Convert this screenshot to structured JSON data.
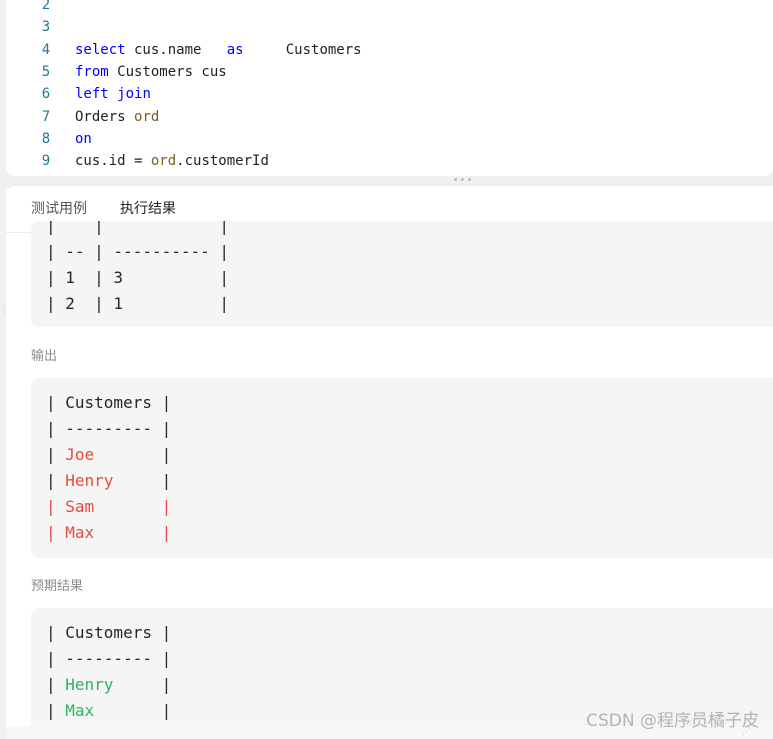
{
  "editor": {
    "lines": [
      {
        "num": "2",
        "tokens": []
      },
      {
        "num": "3",
        "tokens": []
      },
      {
        "num": "4",
        "tokens": [
          {
            "t": "select",
            "c": "kw"
          },
          {
            "t": " cus.name   ",
            "c": ""
          },
          {
            "t": "as",
            "c": "kw"
          },
          {
            "t": "     Customers",
            "c": ""
          }
        ]
      },
      {
        "num": "5",
        "tokens": [
          {
            "t": "from",
            "c": "kw"
          },
          {
            "t": " Customers cus",
            "c": ""
          }
        ]
      },
      {
        "num": "6",
        "tokens": [
          {
            "t": "left",
            "c": "kw"
          },
          {
            "t": " ",
            "c": ""
          },
          {
            "t": "join",
            "c": "kw"
          }
        ]
      },
      {
        "num": "7",
        "tokens": [
          {
            "t": "Orders ",
            "c": ""
          },
          {
            "t": "ord",
            "c": "alias"
          }
        ]
      },
      {
        "num": "8",
        "tokens": [
          {
            "t": "on",
            "c": "kw"
          }
        ]
      },
      {
        "num": "9",
        "tokens": [
          {
            "t": "cus.id = ",
            "c": ""
          },
          {
            "t": "ord",
            "c": "alias"
          },
          {
            "t": ".customerId",
            "c": ""
          }
        ]
      }
    ]
  },
  "tabs": {
    "test_cases": "测试用例",
    "result": "执行结果"
  },
  "input_table": {
    "rows": [
      "| -- | ---------- |",
      "| 1  | 3          |",
      "| 2  | 1          |"
    ],
    "partial_top": "|    |            |"
  },
  "output": {
    "label": "输出",
    "rows": [
      {
        "parts": [
          {
            "t": "| ",
            "c": ""
          },
          {
            "t": "Customers",
            "c": ""
          },
          {
            "t": " |",
            "c": ""
          }
        ]
      },
      {
        "parts": [
          {
            "t": "| --------- |",
            "c": ""
          }
        ]
      },
      {
        "parts": [
          {
            "t": "| ",
            "c": ""
          },
          {
            "t": "Joe",
            "c": "red"
          },
          {
            "t": "       |",
            "c": ""
          }
        ]
      },
      {
        "parts": [
          {
            "t": "| ",
            "c": ""
          },
          {
            "t": "Henry",
            "c": "red"
          },
          {
            "t": "     |",
            "c": ""
          }
        ]
      },
      {
        "parts": [
          {
            "t": "| Sam       |",
            "c": "red"
          }
        ]
      },
      {
        "parts": [
          {
            "t": "| Max       |",
            "c": "red"
          }
        ]
      }
    ]
  },
  "expected": {
    "label": "预期结果",
    "rows": [
      {
        "parts": [
          {
            "t": "| ",
            "c": ""
          },
          {
            "t": "Customers",
            "c": ""
          },
          {
            "t": " |",
            "c": ""
          }
        ]
      },
      {
        "parts": [
          {
            "t": "| --------- |",
            "c": ""
          }
        ]
      },
      {
        "parts": [
          {
            "t": "| ",
            "c": ""
          },
          {
            "t": "Henry",
            "c": "green"
          },
          {
            "t": "     |",
            "c": ""
          }
        ]
      },
      {
        "parts": [
          {
            "t": "| ",
            "c": ""
          },
          {
            "t": "Max",
            "c": "green"
          },
          {
            "t": "       |",
            "c": ""
          }
        ]
      }
    ]
  },
  "watermark": "CSDN @程序员橘子皮",
  "colors": {
    "keyword": "#0000ff",
    "alias": "#795e26",
    "line_number": "#237893",
    "mismatch": "#e74c3c",
    "match": "#2db55d"
  }
}
